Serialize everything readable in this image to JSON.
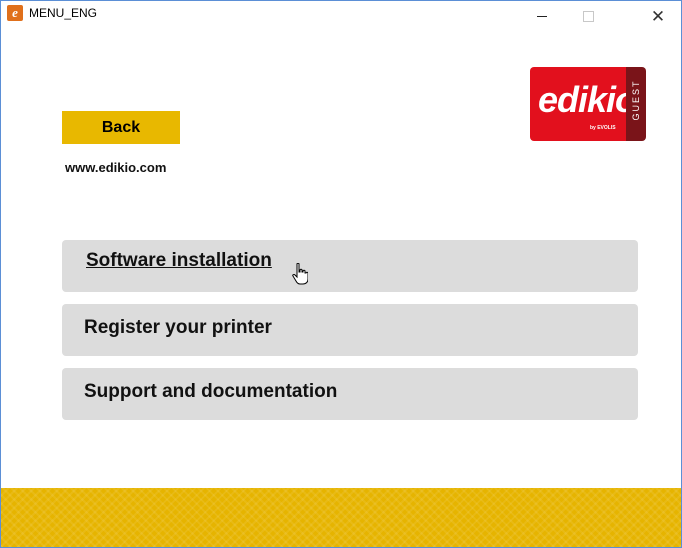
{
  "window": {
    "app_icon_glyph": "e",
    "title": "MENU_ENG",
    "controls": {
      "minimize": "minimize-icon",
      "maximize": "maximize-icon",
      "close": "close-icon",
      "close_glyph": "✕"
    }
  },
  "back": {
    "label": "Back"
  },
  "website": {
    "text": "www.edikio.com"
  },
  "logo": {
    "brand": "edikio",
    "byline": "by EVOLIS",
    "badge": "GUEST",
    "colors": {
      "red": "#e2101d",
      "badge": "#7a1419"
    }
  },
  "menu": {
    "items": [
      {
        "label": "Software installation"
      },
      {
        "label": "Register your printer"
      },
      {
        "label": "Support and documentation"
      }
    ]
  },
  "colors": {
    "accent_yellow": "#e8b800",
    "menu_bg": "#dcdcdc"
  }
}
